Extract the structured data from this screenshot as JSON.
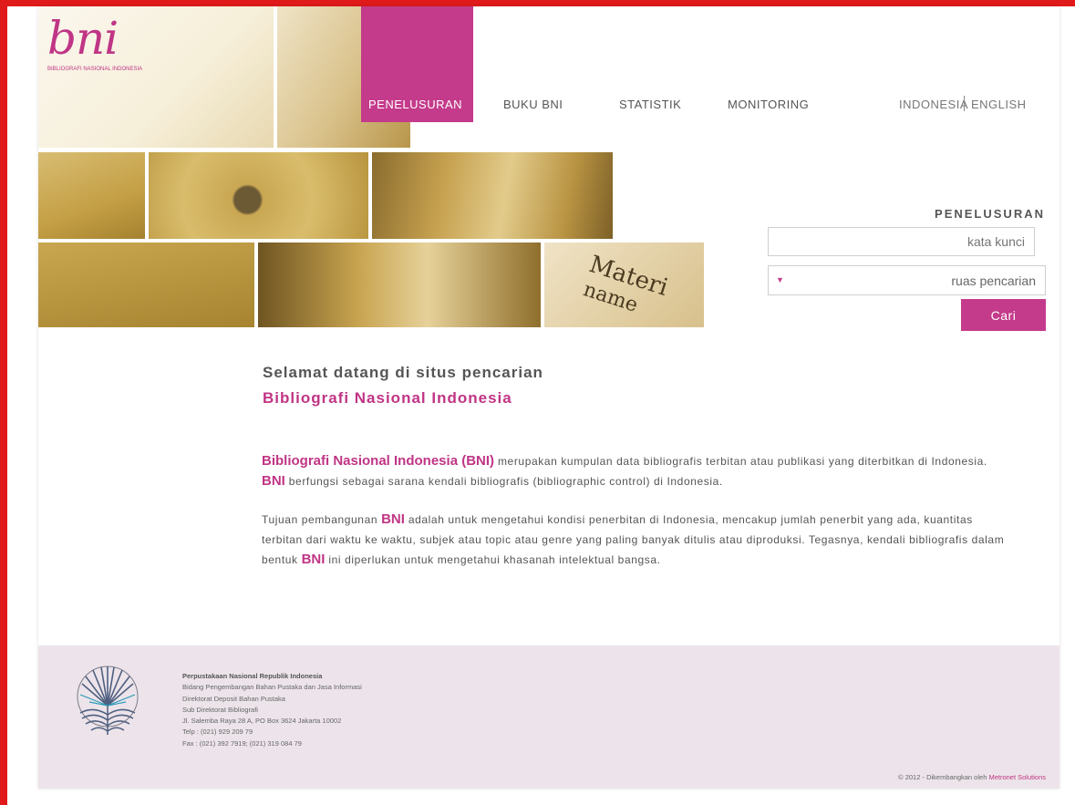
{
  "brand": {
    "logo_text": "bni",
    "logo_subtitle": "BIBLIOGRAFI NASIONAL INDONESIA",
    "accent_color": "#c43b8b"
  },
  "header_photo": {
    "caption_word1": "Materi",
    "caption_word2": "name"
  },
  "nav": {
    "items": [
      {
        "label": "PENELUSURAN",
        "active": true
      },
      {
        "label": "BUKU BNI",
        "active": false
      },
      {
        "label": "STATISTIK",
        "active": false
      },
      {
        "label": "MONITORING",
        "active": false
      }
    ]
  },
  "languages": [
    "INDONESIA",
    "ENGLISH"
  ],
  "search": {
    "title": "PENELUSURAN",
    "keyword_placeholder": "kata kunci",
    "field_value": "ruas pencarian",
    "button_label": "Cari"
  },
  "welcome": {
    "line1": "Selamat datang di situs pencarian",
    "line2": "Bibliografi Nasional Indonesia"
  },
  "intro": {
    "p1_highlight": "Bibliografi Nasional Indonesia (BNI)",
    "p1_text1": " merupakan kumpulan data bibliografis terbitan atau publikasi yang diterbitkan di Indonesia. ",
    "p1_bni": "BNI",
    "p1_text2": " berfungsi sebagai sarana kendali bibliografis (bibliographic control) di Indonesia.",
    "p2_text1": "Tujuan pembangunan ",
    "p2_bni1": "BNI",
    "p2_text2": " adalah untuk mengetahui kondisi penerbitan di Indonesia, mencakup jumlah penerbit yang ada, kuantitas terbitan dari waktu ke waktu, subjek atau topic atau genre yang paling banyak ditulis atau diproduksi. Tegasnya, kendali bibliografis dalam bentuk ",
    "p2_bni2": "BNI",
    "p2_text3": " ini diperlukan untuk mengetahui khasanah intelektual bangsa."
  },
  "footer": {
    "org": "Perpustakaan Nasional Republik Indonesia",
    "lines": [
      "Bidang Pengembangan Bahan Pustaka dan Jasa Informasi",
      "Direktorat Deposit Bahan Pustaka",
      "Sub Direktorat Bibliografi",
      "Jl. Salemba Raya 28 A, PO Box 3624 Jakarta 10002",
      "Telp : (021) 929 209 79",
      "Fax : (021) 392 7919; (021) 319 084 79"
    ],
    "credit_prefix": "© 2012 - Dikembangkan oleh ",
    "credit_link": "Metronet Solutions"
  }
}
